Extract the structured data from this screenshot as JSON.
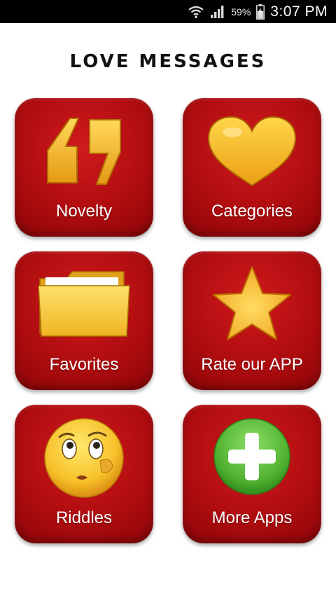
{
  "status_bar": {
    "battery_percent": "59%",
    "time": "3:07 PM",
    "icons": [
      "wifi-icon",
      "signal-icon",
      "battery-icon"
    ]
  },
  "app": {
    "title": "LOVE MESSAGES"
  },
  "menu": {
    "items": [
      {
        "label": "Novelty",
        "icon": "quote-marks-icon"
      },
      {
        "label": "Categories",
        "icon": "heart-icon"
      },
      {
        "label": "Favorites",
        "icon": "folder-icon"
      },
      {
        "label": "Rate our APP",
        "icon": "star-icon"
      },
      {
        "label": "Riddles",
        "icon": "thinking-face-icon"
      },
      {
        "label": "More Apps",
        "icon": "plus-circle-icon"
      }
    ]
  },
  "colors": {
    "tile_red": "#b10d10",
    "icon_yellow": "#f6c62b",
    "plus_green": "#5bb93a",
    "status_bar": "#000000"
  }
}
